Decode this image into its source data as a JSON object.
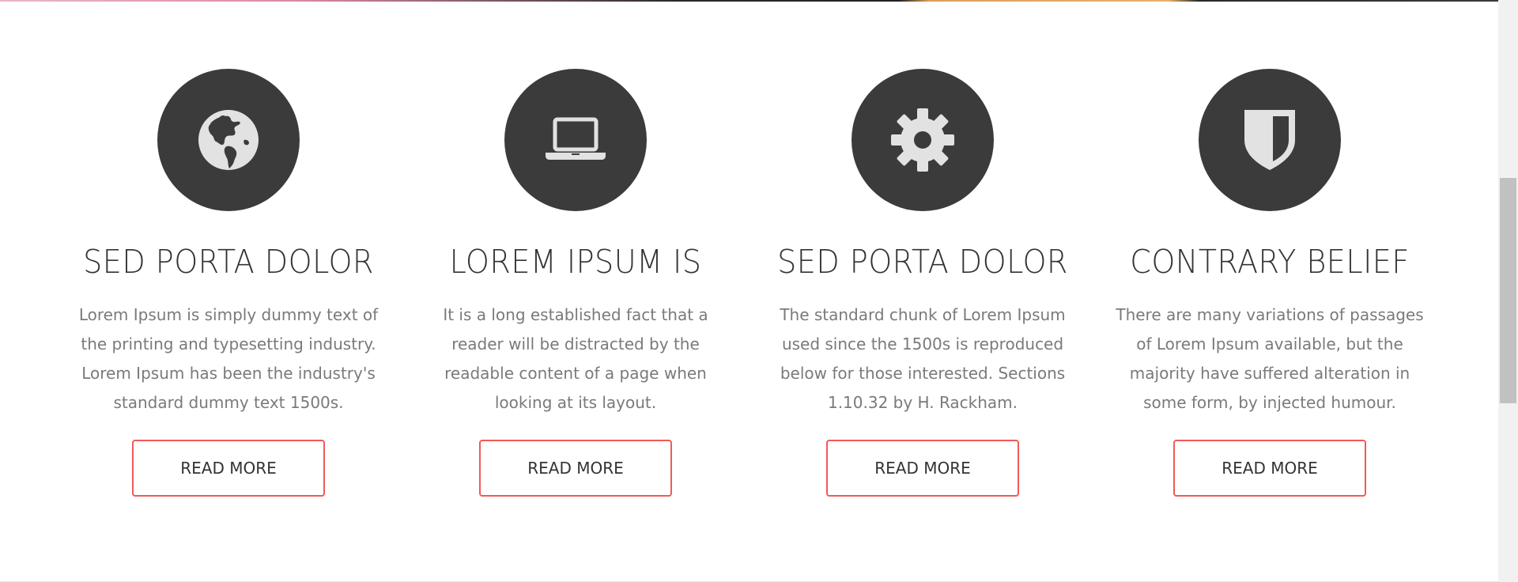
{
  "features": [
    {
      "icon": "globe-icon",
      "title": "SED PORTA DOLOR",
      "text": "Lorem Ipsum is simply dummy text of the printing and typesetting industry. Lorem Ipsum has been the industry's standard dummy text 1500s.",
      "button": "READ MORE"
    },
    {
      "icon": "laptop-icon",
      "title": "LOREM IPSUM IS",
      "text": "It is a long established fact that a reader will be distracted by the readable content of a page when looking at its layout.",
      "button": "READ MORE"
    },
    {
      "icon": "gear-icon",
      "title": "SED PORTA DOLOR",
      "text": "The standard chunk of Lorem Ipsum used since the 1500s is reproduced below for those interested. Sections 1.10.32 by H. Rackham.",
      "button": "READ MORE"
    },
    {
      "icon": "shield-icon",
      "title": "CONTRARY BELIEF",
      "text": "There are many variations of passages of Lorem Ipsum available, but the majority have suffered alteration in some form, by injected humour.",
      "button": "READ MORE"
    }
  ],
  "colors": {
    "icon_circle": "#3b3b3b",
    "icon_glyph": "#e2e2e2",
    "title": "#333333",
    "body_text": "#7a7a7a",
    "button_border": "#f05a5a"
  }
}
